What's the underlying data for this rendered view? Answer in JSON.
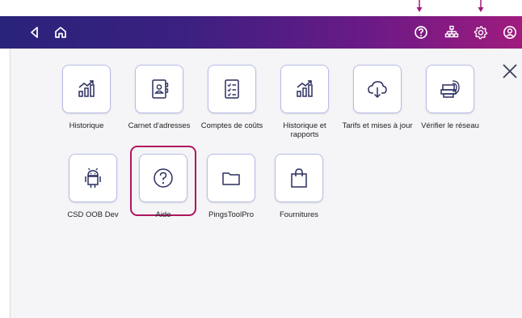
{
  "topbar": {
    "icons": [
      "back-icon",
      "home-icon",
      "help-icon",
      "network-icon",
      "settings-icon",
      "account-icon"
    ]
  },
  "apps": [
    {
      "label": "Historique",
      "icon": "chart-icon"
    },
    {
      "label": "Carnet d'adresses",
      "icon": "address-book-icon"
    },
    {
      "label": "Comptes de coûts",
      "icon": "checklist-icon"
    },
    {
      "label": "Historique et rapports",
      "icon": "chart-icon"
    },
    {
      "label": "Tarifs et mises à jour",
      "icon": "cloud-download-icon"
    },
    {
      "label": "Vérifier le réseau",
      "icon": "network-check-icon"
    },
    {
      "label": "CSD OOB Dev",
      "icon": "android-icon"
    },
    {
      "label": "Aide",
      "icon": "help-icon",
      "selected": true
    },
    {
      "label": "PingsToolPro",
      "icon": "folder-icon"
    },
    {
      "label": "Fournitures",
      "icon": "shopping-bag-icon"
    }
  ],
  "colors": {
    "accent": "#b0155f",
    "tile_border": "#b9bde8",
    "icon_stroke": "#2b2f5e"
  }
}
